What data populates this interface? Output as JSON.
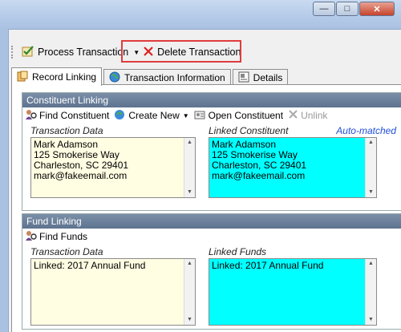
{
  "toolbar": {
    "process_label": "Process Transaction",
    "delete_label": "Delete Transaction"
  },
  "tabs": [
    {
      "label": "Record Linking",
      "icon": "link-icon",
      "active": true
    },
    {
      "label": "Transaction Information",
      "icon": "globe-icon",
      "active": false
    },
    {
      "label": "Details",
      "icon": "details-icon",
      "active": false
    }
  ],
  "constituent_linking": {
    "header": "Constituent Linking",
    "find_label": "Find Constituent",
    "create_label": "Create New",
    "open_label": "Open Constituent",
    "unlink_label": "Unlink",
    "transaction_data_label": "Transaction Data",
    "linked_label": "Linked Constituent",
    "auto_matched": "Auto-matched",
    "transaction_lines": [
      "Mark Adamson",
      "125 Smokerise Way",
      "Charleston, SC  29401",
      "mark@fakeemail.com"
    ],
    "linked_lines": [
      "Mark Adamson",
      "125 Smokerise Way",
      "Charleston, SC  29401",
      "mark@fakeemail.com"
    ]
  },
  "fund_linking": {
    "header": "Fund Linking",
    "find_label": "Find Funds",
    "transaction_data_label": "Transaction Data",
    "linked_label": "Linked Funds",
    "transaction_lines": [
      "Linked: 2017 Annual Fund"
    ],
    "linked_lines": [
      "Linked: 2017 Annual Fund"
    ]
  },
  "colors": {
    "linked_bg": "#00ffff",
    "transaction_bg": "#fffde2",
    "highlight": "#e03c3c",
    "auto_matched": "#1f4fd8"
  }
}
